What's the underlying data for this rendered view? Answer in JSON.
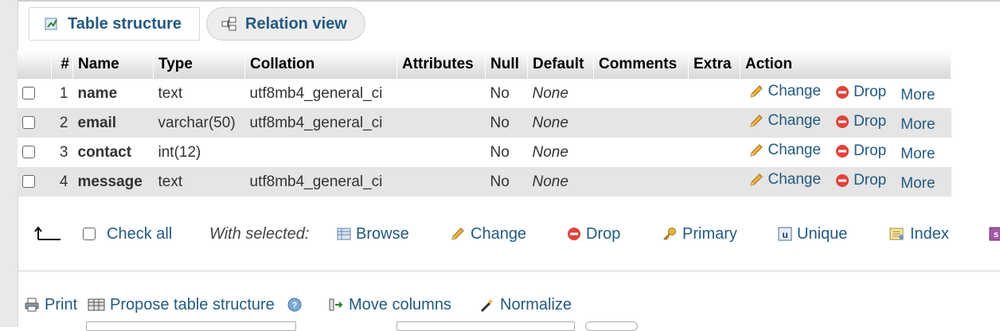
{
  "tabs": {
    "table_structure": "Table structure",
    "relation_view": "Relation view"
  },
  "columns": [
    "#",
    "Name",
    "Type",
    "Collation",
    "Attributes",
    "Null",
    "Default",
    "Comments",
    "Extra",
    "Action"
  ],
  "rows": [
    {
      "num": "1",
      "name": "name",
      "type": "text",
      "collation": "utf8mb4_general_ci",
      "attributes": "",
      "null": "No",
      "default": "None",
      "comments": "",
      "extra": ""
    },
    {
      "num": "2",
      "name": "email",
      "type": "varchar(50)",
      "collation": "utf8mb4_general_ci",
      "attributes": "",
      "null": "No",
      "default": "None",
      "comments": "",
      "extra": ""
    },
    {
      "num": "3",
      "name": "contact",
      "type": "int(12)",
      "collation": "",
      "attributes": "",
      "null": "No",
      "default": "None",
      "comments": "",
      "extra": ""
    },
    {
      "num": "4",
      "name": "message",
      "type": "text",
      "collation": "utf8mb4_general_ci",
      "attributes": "",
      "null": "No",
      "default": "None",
      "comments": "",
      "extra": ""
    }
  ],
  "row_actions": {
    "change": "Change",
    "drop": "Drop",
    "more": "More"
  },
  "bulk": {
    "check_all": "Check all",
    "with_selected": "With selected:",
    "browse": "Browse",
    "change": "Change",
    "drop": "Drop",
    "primary": "Primary",
    "unique": "Unique",
    "index": "Index"
  },
  "tools": {
    "print": "Print",
    "propose": "Propose table structure",
    "move_columns": "Move columns",
    "normalize": "Normalize"
  },
  "colors": {
    "link": "#235a81",
    "drop_red": "#e0433b",
    "row_alt": "#e5e5e5"
  }
}
